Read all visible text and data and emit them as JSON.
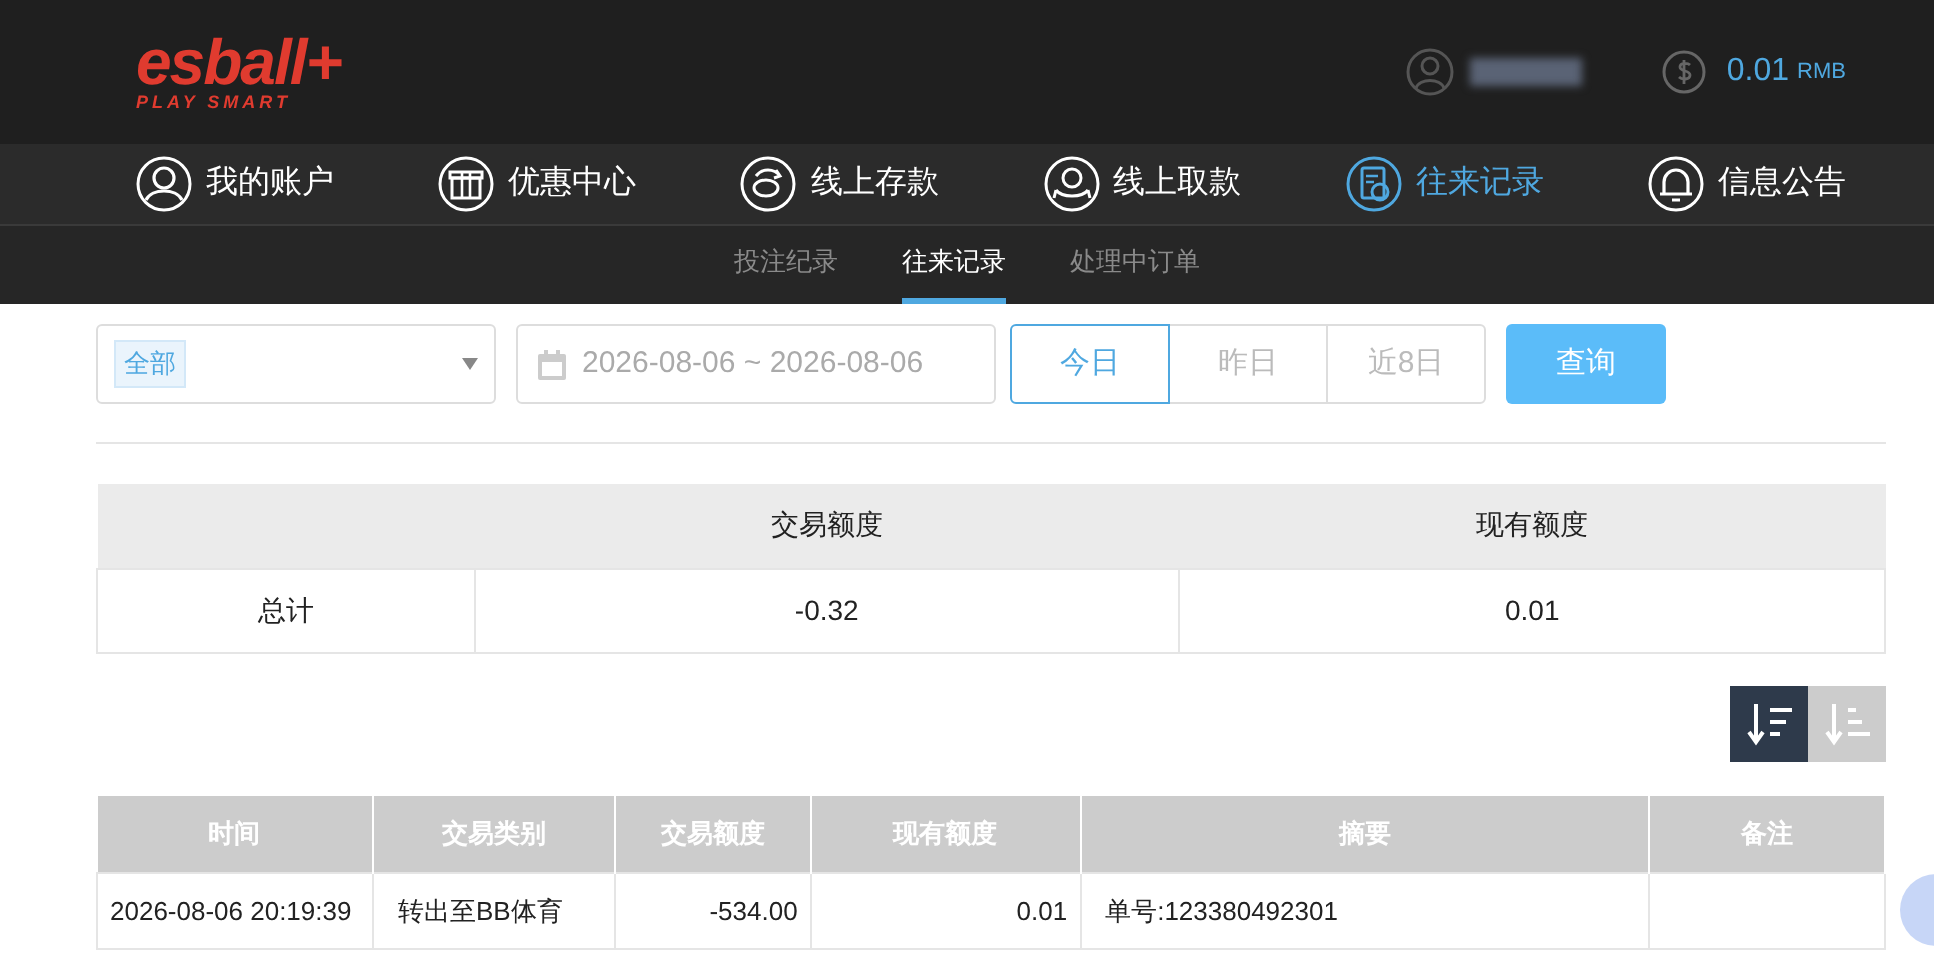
{
  "header": {
    "logo": {
      "text": "esball+",
      "tagline": "PLAY SMART"
    },
    "balance": {
      "amount": "0.01",
      "currency": "RMB"
    }
  },
  "nav": [
    {
      "label": "我的账户",
      "kind": "user",
      "selected": false
    },
    {
      "label": "优惠中心",
      "kind": "gift",
      "selected": false
    },
    {
      "label": "线上存款",
      "kind": "deposit",
      "selected": false
    },
    {
      "label": "线上取款",
      "kind": "withdraw",
      "selected": false
    },
    {
      "label": "往来记录",
      "kind": "record",
      "selected": true
    },
    {
      "label": "信息公告",
      "kind": "bell",
      "selected": false
    }
  ],
  "subtabs": [
    {
      "label": "投注纪录",
      "selected": false
    },
    {
      "label": "往来记录",
      "selected": true
    },
    {
      "label": "处理中订单",
      "selected": false
    }
  ],
  "filter": {
    "type_tag": "全部",
    "date_range": "2026-08-06 ~ 2026-08-06",
    "ranges": [
      {
        "label": "今日",
        "selected": true
      },
      {
        "label": "昨日",
        "selected": false
      },
      {
        "label": "近8日",
        "selected": false
      }
    ],
    "query_button": "查询"
  },
  "summary": {
    "columns": [
      "",
      "交易额度",
      "现有额度"
    ],
    "rows": [
      [
        "总计",
        "-0.32",
        "0.01"
      ]
    ]
  },
  "sort": [
    {
      "kind": "desc",
      "selected": true
    },
    {
      "kind": "asc",
      "selected": false
    }
  ],
  "table": {
    "columns": [
      "时间",
      "交易类别",
      "交易额度",
      "现有额度",
      "摘要",
      "备注"
    ],
    "rows": [
      [
        "2026-08-06 20:19:39",
        "转出至BB体育",
        "-534.00",
        "0.01",
        "单号:123380492301",
        ""
      ]
    ]
  }
}
